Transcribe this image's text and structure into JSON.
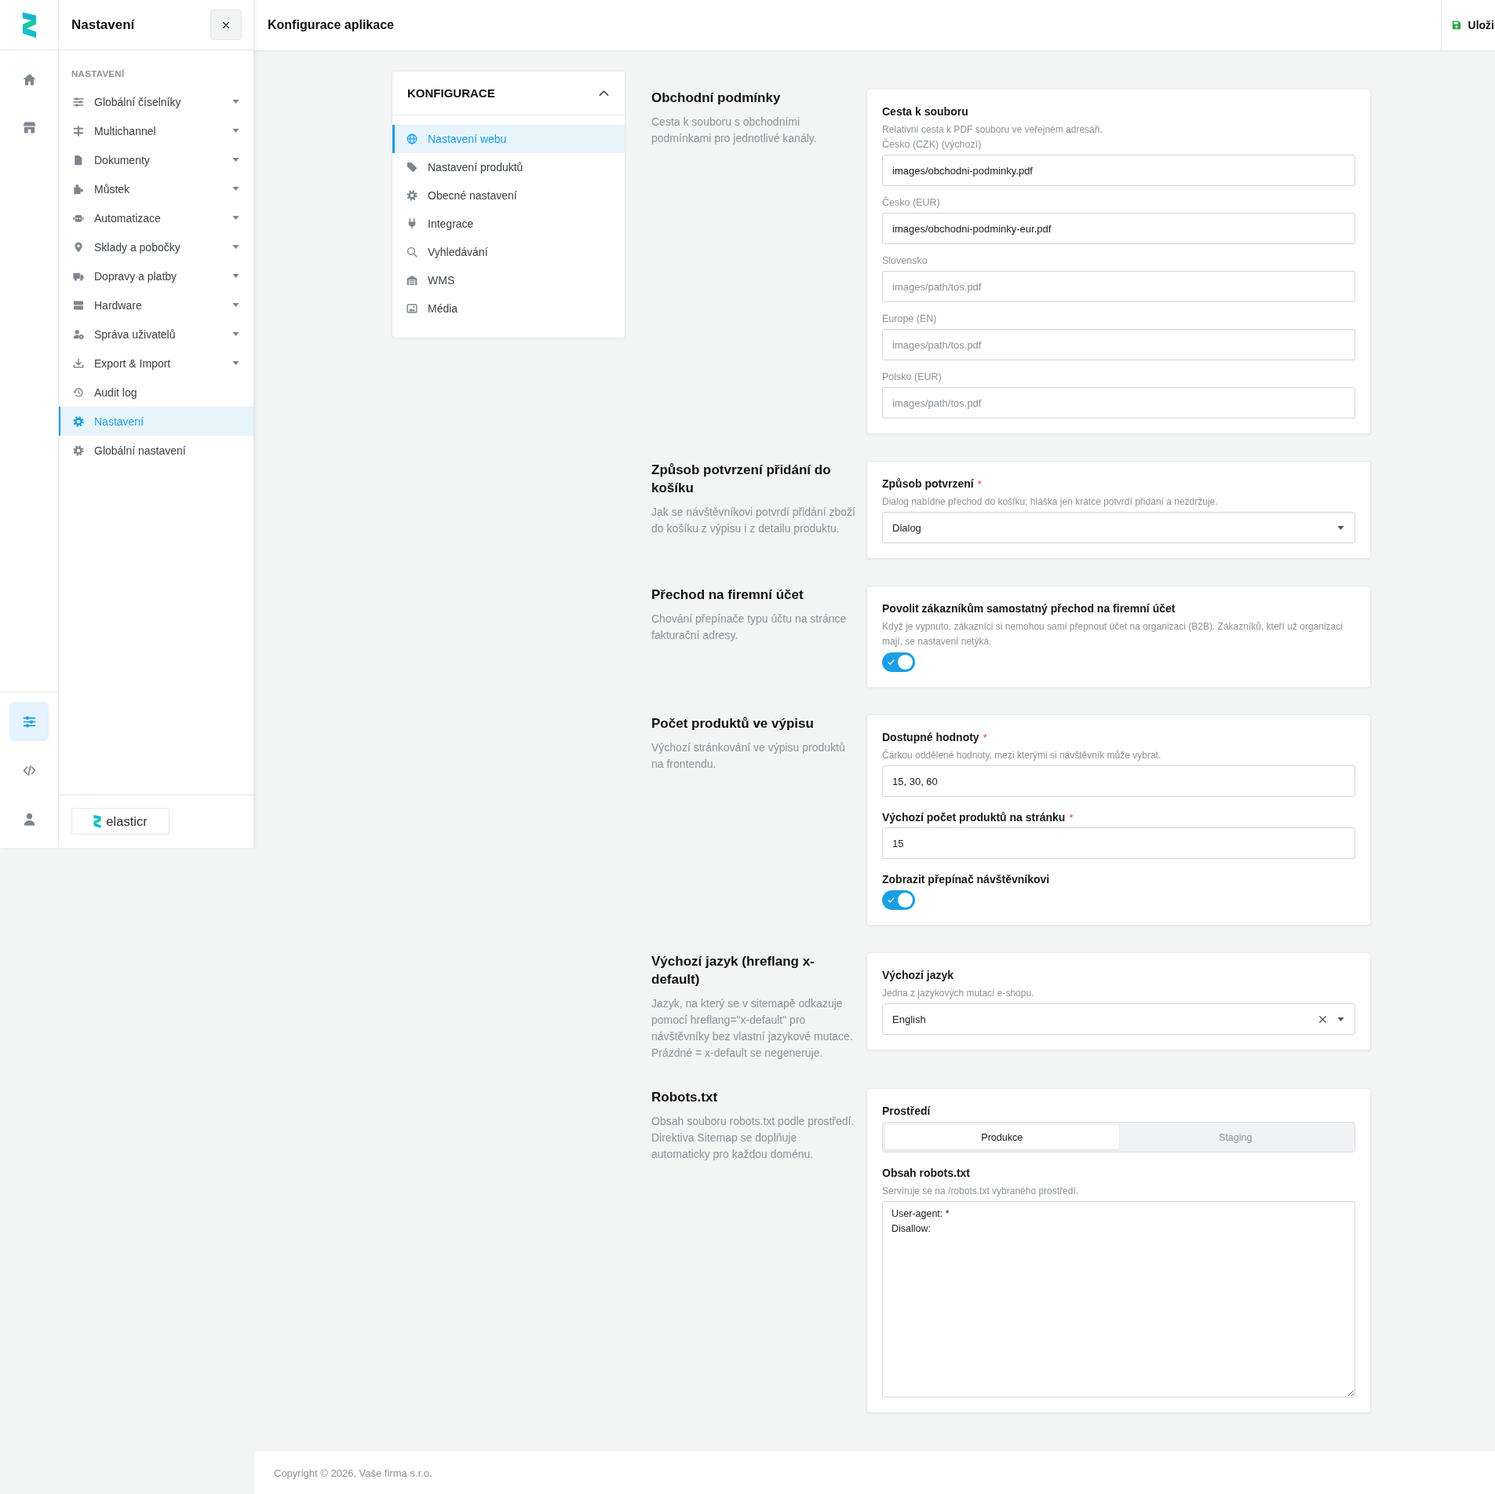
{
  "app_rail": {
    "top_items": [
      {
        "selected": false
      },
      {
        "selected": false
      }
    ],
    "bottom_items": [
      {
        "selected": true
      },
      {
        "selected": false
      },
      {
        "selected": false
      }
    ]
  },
  "sidebar": {
    "title": "Nastavení",
    "section_label": "NASTAVENÍ",
    "items": [
      {
        "label": "Globální číselníky",
        "expandable": true,
        "selected": false
      },
      {
        "label": "Multichannel",
        "expandable": true,
        "selected": false
      },
      {
        "label": "Dokumenty",
        "expandable": true,
        "selected": false
      },
      {
        "label": "Můstek",
        "expandable": true,
        "selected": false
      },
      {
        "label": "Automatizace",
        "expandable": true,
        "selected": false
      },
      {
        "label": "Sklady a pobočky",
        "expandable": true,
        "selected": false
      },
      {
        "label": "Dopravy a platby",
        "expandable": true,
        "selected": false
      },
      {
        "label": "Hardware",
        "expandable": true,
        "selected": false
      },
      {
        "label": "Správa uživatelů",
        "expandable": true,
        "selected": false
      },
      {
        "label": "Export & Import",
        "expandable": true,
        "selected": false
      },
      {
        "label": "Audit log",
        "expandable": false,
        "selected": false
      },
      {
        "label": "Nastavení",
        "expandable": false,
        "selected": true
      },
      {
        "label": "Globální nastavení",
        "expandable": false,
        "selected": false
      }
    ],
    "brand": "elasticr"
  },
  "header": {
    "title": "Konfigurace aplikace",
    "save_button": "Uloži"
  },
  "config_menu": {
    "title": "KONFIGURACE",
    "expanded": true,
    "items": [
      {
        "label": "Nastavení webu",
        "selected": true
      },
      {
        "label": "Nastavení produktů",
        "selected": false
      },
      {
        "label": "Obecné nastavení",
        "selected": false
      },
      {
        "label": "Integrace",
        "selected": false
      },
      {
        "label": "Vyhledávání",
        "selected": false
      },
      {
        "label": "WMS",
        "selected": false
      },
      {
        "label": "Média",
        "selected": false
      }
    ]
  },
  "sections": [
    {
      "title": "Obchodní podmínky",
      "description": "Cesta k souboru s obchodními podmínkami pro jednotlivé kanály.",
      "fields": [
        {
          "kind": "group",
          "label": "Cesta k souboru",
          "help": "Relativní cesta k PDF souboru ve veřejném adresáři.",
          "inputs": [
            {
              "label": "Česko (CZK) (výchozí)",
              "value": "images/obchodni-podminky.pdf"
            },
            {
              "label": "Česko (EUR)",
              "value": "images/obchodni-podminky-eur.pdf"
            },
            {
              "label": "Slovensko",
              "placeholder": "images/path/tos.pdf"
            },
            {
              "label": "Europe (EN)",
              "placeholder": "images/path/tos.pdf"
            },
            {
              "label": "Polsko (EUR)",
              "placeholder": "images/path/tos.pdf"
            }
          ]
        }
      ]
    },
    {
      "title": "Způsob potvrzení přidání do košíku",
      "description": "Jak se návštěvníkovi potvrdí přidání zboží do košíku z výpisu i z detailu produktu.",
      "fields": [
        {
          "kind": "select",
          "label": "Způsob potvrzení",
          "required_mark": "*",
          "help": "Dialog nabídne přechod do košíku; hláška jen krátce potvrdí přidání a nezdržuje.",
          "value": "Dialog",
          "clearable": false
        }
      ]
    },
    {
      "title": "Přechod na firemní účet",
      "description": "Chování přepínače typu účtu na stránce fakturační adresy.",
      "fields": [
        {
          "kind": "toggle",
          "label": "Povolit zákazníkům samostatný přechod na firemní účet",
          "help": "Když je vypnuto, zákazníci si nemohou sami přepnout účet na organizaci (B2B). Zákazníků, kteří už organizaci mají, se nastavení netýká.",
          "on": true
        }
      ]
    },
    {
      "title": "Počet produktů ve výpisu",
      "description": "Výchozí stránkování ve výpisu produktů na frontendu.",
      "fields": [
        {
          "kind": "text",
          "label": "Dostupné hodnoty",
          "required_mark": "*",
          "help": "Čárkou oddělené hodnoty, mezi kterými si návštěvník může vybrat.",
          "value": "15, 30, 60"
        },
        {
          "kind": "text",
          "label": "Výchozí počet produktů na stránku",
          "required_mark": "*",
          "value": "15"
        },
        {
          "kind": "toggle",
          "label": "Zobrazit přepínač návštěvníkovi",
          "on": true
        }
      ]
    },
    {
      "title": "Výchozí jazyk (hreflang x-default)",
      "description": "Jazyk, na který se v sitemapě odkazuje pomocí hreflang=\"x-default\" pro návštěvníky bez vlastní jazykové mutace. Prázdné = x-default se negeneruje.",
      "fields": [
        {
          "kind": "select",
          "label": "Výchozí jazyk",
          "help": "Jedna z jazykových mutací e-shopu.",
          "value": "English",
          "clearable": true
        }
      ]
    },
    {
      "title": "Robots.txt",
      "description": "Obsah souboru robots.txt podle prostředí. Direktiva Sitemap se doplňuje automaticky pro každou doménu.",
      "fields": [
        {
          "kind": "segmented",
          "label": "Prostředí",
          "options": [
            {
              "label": "Produkce",
              "selected": true
            },
            {
              "label": "Staging",
              "selected": false
            }
          ]
        },
        {
          "kind": "textarea",
          "label": "Obsah robots.txt",
          "help": "Servíruje se na /robots.txt vybraného prostředí.",
          "value": "User-agent: *\nDisallow:"
        }
      ]
    }
  ],
  "footer": {
    "text": "Copyright © 2026, Vaše firma s.r.o."
  }
}
